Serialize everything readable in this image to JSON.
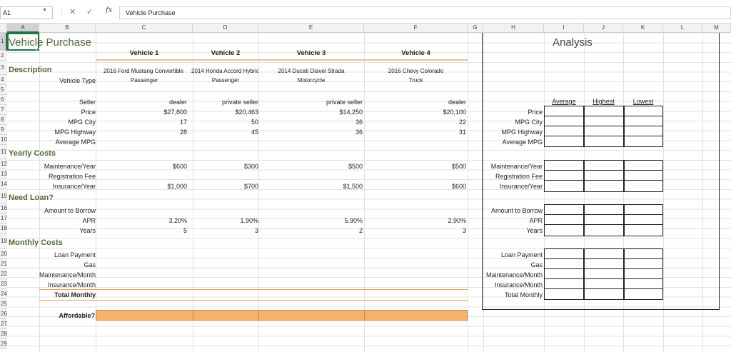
{
  "formula_bar": {
    "name_box": "A1",
    "cancel_icon": "✕",
    "enter_icon": "✓",
    "fx_label": "fx",
    "content": "Vehicle Purchase"
  },
  "columns": [
    "A",
    "B",
    "C",
    "D",
    "E",
    "F",
    "G",
    "H",
    "I",
    "J",
    "K",
    "L",
    "M"
  ],
  "rows": [
    "1",
    "2",
    "3",
    "4",
    "5",
    "6",
    "7",
    "8",
    "9",
    "10",
    "11",
    "12",
    "13",
    "14",
    "15",
    "16",
    "17",
    "18",
    "19",
    "20",
    "21",
    "22",
    "23",
    "24",
    "25",
    "26",
    "27",
    "28",
    "29"
  ],
  "sheet": {
    "title": "Vehicle Purchase",
    "vehicle_headers": [
      "Vehicle 1",
      "Vehicle 2",
      "Vehicle 3",
      "Vehicle 4"
    ],
    "description_label": "Description",
    "vehicle_type_label": "Vehicle Type",
    "descriptions": [
      "2016 Ford Mustang Convertible",
      "2014 Honda Accord Hybrid",
      "2014 Ducati Diavel Strada",
      "2016 Chevy Colorado"
    ],
    "vehicle_types": [
      "Passenger",
      "Passenger",
      "Motorcycle",
      "Truck"
    ],
    "labels": {
      "seller": "Seller",
      "price": "Price",
      "mpg_city": "MPG City",
      "mpg_highway": "MPG Highway",
      "average_mpg": "Average MPG",
      "yearly_costs": "Yearly Costs",
      "maintenance_year": "Maintenance/Year",
      "registration_fee": "Registration Fee",
      "insurance_year": "Insurance/Year",
      "need_loan": "Need Loan?",
      "amount_to_borrow": "Amount to Borrow",
      "apr": "APR",
      "years": "Years",
      "monthly_costs": "Monthly Costs",
      "loan_payment": "Loan Payment",
      "gas": "Gas",
      "maintenance_month": "Maintenance/Month",
      "insurance_month": "Insurance/Month",
      "total_monthly": "Total Monthly",
      "affordable": "Affordable?"
    },
    "sellers": [
      "dealer",
      "private seller",
      "private seller",
      "dealer"
    ],
    "prices": [
      "$27,800",
      "$20,463",
      "$14,250",
      "$20,100"
    ],
    "mpg_city": [
      "17",
      "50",
      "36",
      "22"
    ],
    "mpg_highway": [
      "28",
      "45",
      "36",
      "31"
    ],
    "maintenance_year": [
      "$600",
      "$300",
      "$500",
      "$500"
    ],
    "insurance_year": [
      "$1,000",
      "$700",
      "$1,500",
      "$600"
    ],
    "apr": [
      "3.20%",
      "1.90%",
      "5.90%",
      "2.90%"
    ],
    "years": [
      "5",
      "3",
      "2",
      "3"
    ]
  },
  "analysis": {
    "title": "Analysis",
    "col_headers": [
      "Average",
      "Highest",
      "Lowest"
    ],
    "group1": [
      "Price",
      "MPG City",
      "MPG Highway",
      "Average MPG"
    ],
    "group2": [
      "Maintenance/Year",
      "Registration Fee",
      "Insurance/Year"
    ],
    "group3": [
      "Amount to Borrow",
      "APR",
      "Years"
    ],
    "group4": [
      "Loan Payment",
      "Gas",
      "Maintenance/Month",
      "Insurance/Month",
      "Total Monthly"
    ]
  },
  "colors": {
    "section_text": "#506b38",
    "highlight_fill": "#f5b26b",
    "selection": "#217346"
  }
}
